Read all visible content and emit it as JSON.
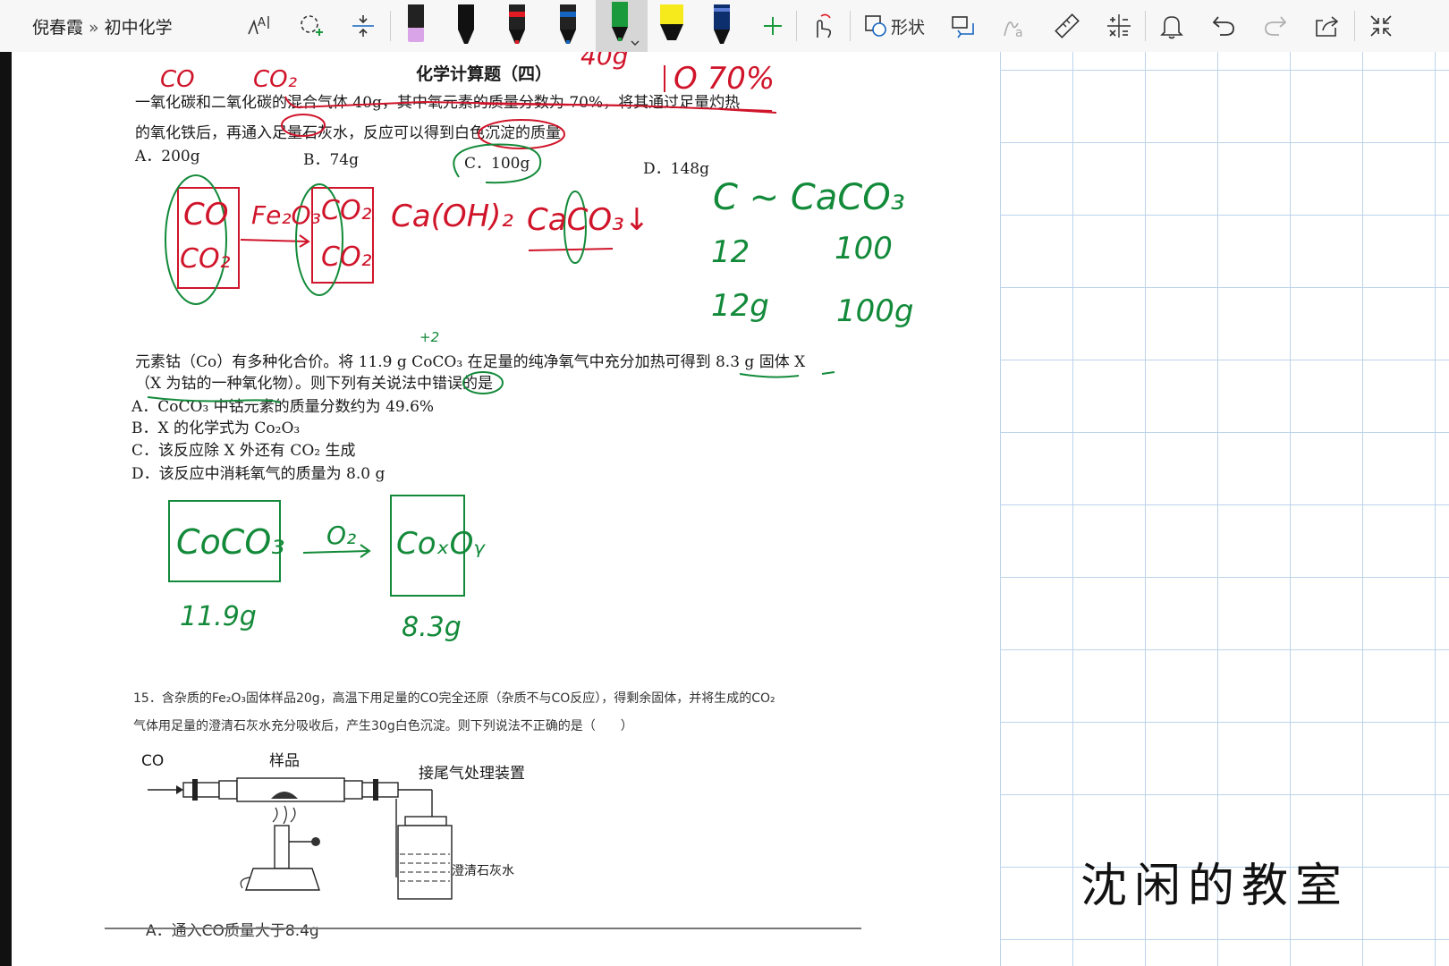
{
  "breadcrumb": {
    "notebook": "倪春霞",
    "separator": "»",
    "section": "初中化学"
  },
  "toolbar": {
    "shape_label": "形状",
    "pens": [
      {
        "name": "purple",
        "color": "#d9a4e8"
      },
      {
        "name": "black",
        "color": "#111111"
      },
      {
        "name": "red",
        "color": "#e01b24"
      },
      {
        "name": "blue",
        "color": "#1565c0"
      },
      {
        "name": "green",
        "color": "#1a9a3c"
      },
      {
        "name": "yellow",
        "color": "#f6ea1c"
      },
      {
        "name": "navy",
        "color": "#0d2f6e"
      }
    ]
  },
  "colors": {
    "ink_red": "#d0142a",
    "ink_green": "#138a3a",
    "grid": "#bcd3ea"
  },
  "doc": {
    "title": "化学计算题（四）",
    "q1_line1": "一氧化碳和二氧化碳的混合气体 40g，其中氧元素的质量分数为 70%，将其通过足量灼热",
    "q1_line2": "的氧化铁后，再通入足量石灰水，反应可以得到白色沉淀的质量",
    "q1_opt_a": "A．200g",
    "q1_opt_b": "B．74g",
    "q1_opt_c": "C．100g",
    "q1_opt_d": "D．148g",
    "q2_line1": "元素钴（Co）有多种化合价。将 11.9 g CoCO₃ 在足量的纯净氧气中充分加热可得到 8.3 g 固体 X",
    "q2_line2": "（X 为钴的一种氧化物）。则下列有关说法中错误的是",
    "q2_opt_a": "A．CoCO₃ 中钴元素的质量分数约为 49.6%",
    "q2_opt_b": "B．X 的化学式为 Co₂O₃",
    "q2_opt_c": "C．该反应除 X 外还有 CO₂ 生成",
    "q2_opt_d": "D．该反应中消耗氧气的质量为 8.0 g",
    "q3_line1": "15．含杂质的Fe₂O₃固体样品20g，高温下用足量的CO完全还原（杂质不与CO反应），得剩余固体，并将生成的CO₂",
    "q3_line2": "气体用足量的澄清石灰水充分吸收后，产生30g白色沉淀。则下列说法不正确的是（　　）",
    "fig_co": "CO",
    "fig_sample": "样品",
    "fig_tail": "接尾气处理装置",
    "fig_limewater": "—澄清石灰水",
    "q3_opt_a": "A．通入CO质量大于8.4g"
  },
  "ink": {
    "co": "CO",
    "co2": "CO₂",
    "mass_40g": "40g",
    "o70": "O 70%",
    "plus2": "+2",
    "box_co": "CO",
    "box_co2": "CO₂",
    "fe2o3": "Fe₂O₃",
    "box2_co2_a": "CO₂",
    "box2_co2_b": "CO₂",
    "caoh2": "Ca(OH)₂",
    "caco3": "CaCO₃↓",
    "c_caco3": "C ~ CaCO₃",
    "n12": "12",
    "n100": "100",
    "n12g": "12g",
    "n100g": "100g",
    "coco3": "CoCO₃",
    "o2": "O₂",
    "coxoy": "CoₓOᵧ",
    "m119": "11.9g",
    "m83": "8.3g"
  },
  "watermark": "沈闲的教室"
}
